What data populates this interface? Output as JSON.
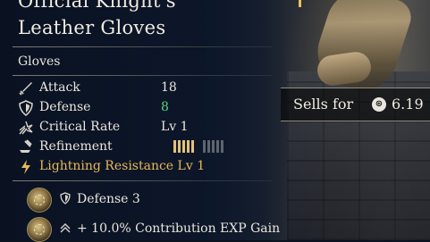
{
  "item": {
    "title": "Official Knight's\nLeather Gloves",
    "category": "Gloves"
  },
  "stats": [
    {
      "icon": "sword-icon",
      "label": "Attack",
      "value": "18"
    },
    {
      "icon": "shield-icon",
      "label": "Defense",
      "value": "8"
    },
    {
      "icon": "critical-burst-icon",
      "label": "Critical Rate",
      "value": "Lv 1"
    },
    {
      "icon": "anvil-hammer-icon",
      "label": "Refinement",
      "value": ""
    }
  ],
  "refinement": {
    "filled": 5,
    "total": 10
  },
  "special": {
    "icon": "lightning-icon",
    "label": "Lightning Resistance Lv 1"
  },
  "perks": [
    {
      "emblem": "bronze-medal-emblem",
      "icon": "shield-icon",
      "text": "Defense 3"
    },
    {
      "emblem": "bronze-medal-emblem",
      "icon": "rank-up-icon",
      "text": "+ 10.0% Contribution EXP Gain"
    }
  ],
  "sell": {
    "label": "Sells for",
    "currency_icon": "coin-icon",
    "amount": "6.19"
  },
  "colors": {
    "stat_positive": "#5fd37a",
    "gold": "#e8b85a",
    "refine_filled": "#e2c27a"
  }
}
